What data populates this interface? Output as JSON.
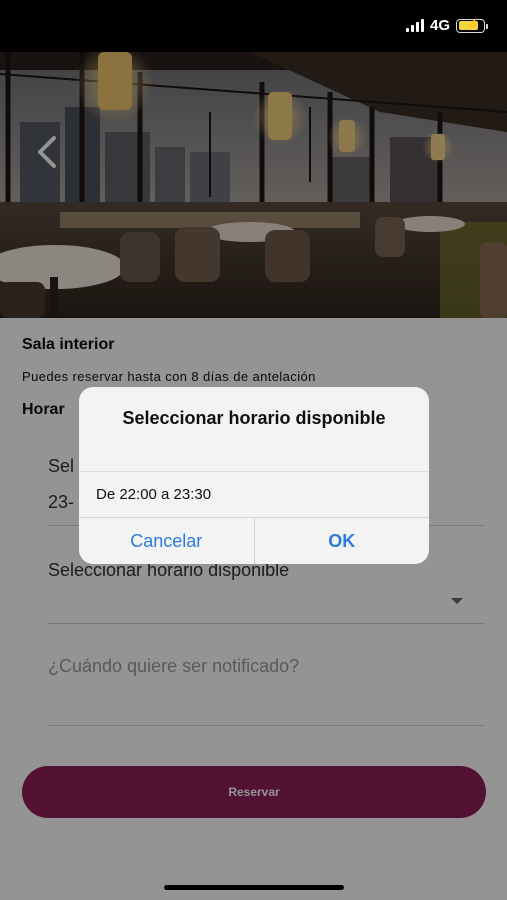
{
  "status_bar": {
    "network": "4G",
    "signal_bars": 4,
    "battery_level": 0.8,
    "battery_color": "#f3d438",
    "icons": [
      "signal-bars-icon",
      "battery-charging-icon"
    ]
  },
  "hero": {
    "back_icon": "chevron-left-icon"
  },
  "booking": {
    "room_title": "Sala interior",
    "advance_note": "Puedes reservar hasta con 8 días de antelación",
    "section_heading": "Horar",
    "date_label": "Sel",
    "date_value": "23-",
    "time_placeholder": "Seleccionar horario disponible",
    "notify_placeholder": "¿Cuándo quiere ser notificado?",
    "reserve_label": "Reservar",
    "reserve_color": "#8e1c56"
  },
  "dialog": {
    "title": "Seleccionar horario disponible",
    "option": "De 22:00 a 23:30",
    "cancel_label": "Cancelar",
    "ok_label": "OK",
    "button_color": "#2d7bd8"
  }
}
